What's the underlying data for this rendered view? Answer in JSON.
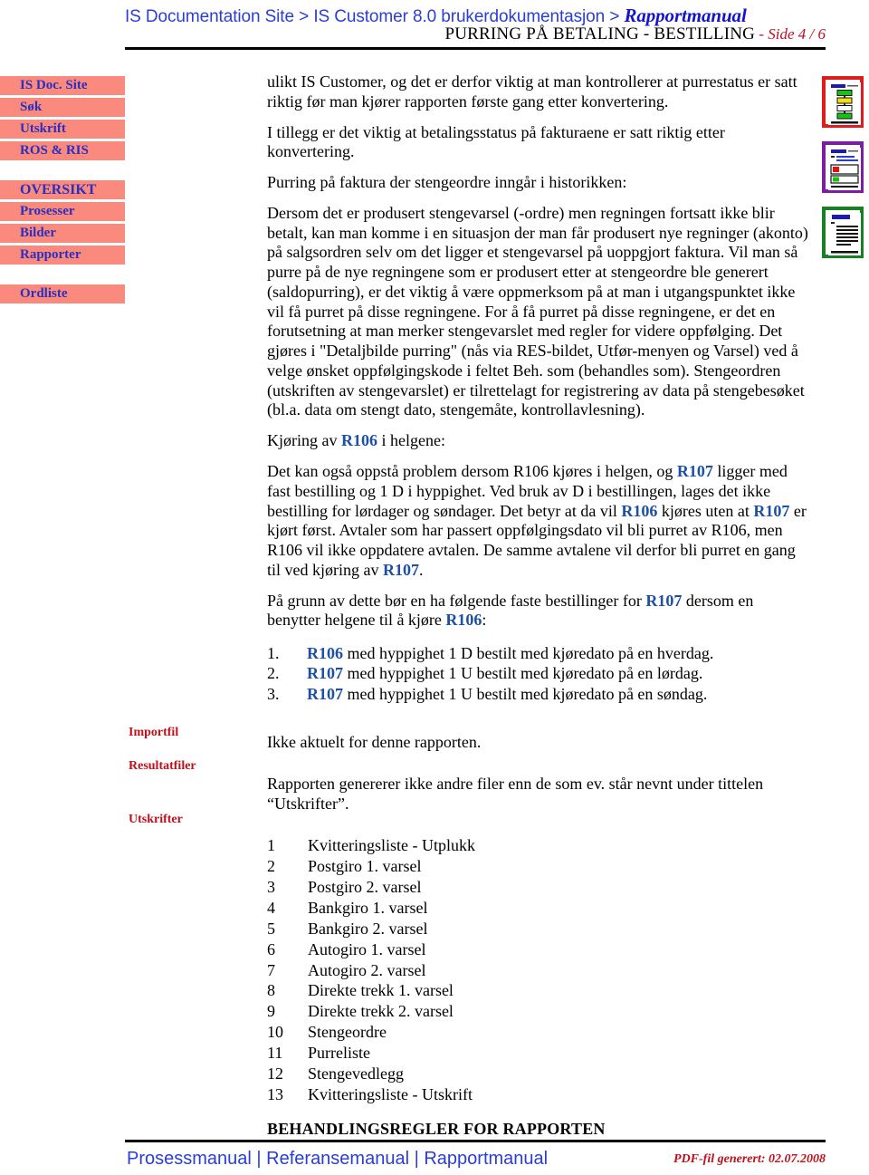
{
  "header": {
    "breadcrumb_part1": "IS Documentation Site",
    "breadcrumb_sep1": " > ",
    "breadcrumb_part2": "IS Customer 8.0 brukerdokumentasjon",
    "breadcrumb_sep2": " > ",
    "breadcrumb_part3": "Rapportmanual",
    "doc_title": "PURRING PÅ BETALING - BESTILLING",
    "page_indicator": " - Side 4 / 6"
  },
  "sidebar": {
    "group1": [
      {
        "label": "IS Doc. Site"
      },
      {
        "label": "Søk"
      },
      {
        "label": "Utskrift"
      },
      {
        "label": "ROS & RIS"
      }
    ],
    "group2": [
      {
        "label": "OVERSIKT"
      },
      {
        "label": "Prosesser"
      },
      {
        "label": "Bilder"
      },
      {
        "label": "Rapporter"
      }
    ],
    "group3": [
      {
        "label": "Ordliste"
      }
    ]
  },
  "side_labels": {
    "importfil": "Importfil",
    "resultatfiler": "Resultatfiler",
    "utskrifter": "Utskrifter"
  },
  "main": {
    "p1": "ulikt IS Customer, og det er derfor viktig at man kontrollerer at purrestatus er satt riktig før man kjører rapporten første gang etter konvertering.",
    "p2": "I tillegg er det viktig at betalingsstatus på fakturaene er satt riktig etter konvertering.",
    "p3": "Purring på faktura der stengeordre inngår i historikken:",
    "p4": "Dersom det er produsert stengevarsel (-ordre) men regningen fortsatt ikke blir betalt, kan man komme i en situasjon der man får produsert nye regninger (akonto) på salgsordren selv om det ligger et stengevarsel på uoppgjort faktura. Vil man så purre på de nye regningene som er produsert etter at stengeordre ble generert (saldopurring), er det viktig å være oppmerksom på at man i utgangspunktet ikke vil få purret på disse regningene. For å få purret på disse regningene, er det en forutsetning at man merker stengevarslet med regler for videre oppfølging. Det gjøres i \"Detaljbilde purring\" (nås via RES-bildet, Utfør-menyen og Varsel) ved å velge ønsket oppfølgingskode i feltet Beh. som (behandles som). Stengeordren (utskriften av stengevarslet) er tilrettelagt for registrering av data på stengebesøket (bl.a. data om stengt dato, stengemåte, kontrollavlesning).",
    "p5_prefix": "Kjøring av ",
    "p5_code": "R106",
    "p5_suffix": " i helgene:",
    "p6_seg1": "Det kan også oppstå problem dersom R106 kjøres i helgen, og ",
    "p6_code1": "R107",
    "p6_seg2": " ligger med fast bestilling og 1 D i hyppighet. Ved bruk av D i bestillingen, lages det ikke bestilling for lørdager og søndager. Det betyr at da vil ",
    "p6_code2": "R106",
    "p6_seg3": " kjøres uten at ",
    "p6_code3": "R107",
    "p6_seg4": " er kjørt først. Avtaler som har passert oppfølgingsdato vil bli purret av R106, men R106 vil ikke oppdatere avtalen. De samme avtalene vil derfor bli purret en gang til ved kjøring av ",
    "p6_code4": "R107",
    "p6_seg5": ".",
    "p7_seg1": "På grunn av dette bør en ha følgende faste bestillinger for ",
    "p7_code1": "R107",
    "p7_seg2": " dersom en benytter helgene til å kjøre ",
    "p7_code2": "R106",
    "p7_seg3": ":",
    "numbered_list": [
      {
        "num": "1.",
        "code": "R106",
        "text": " med hyppighet 1 D bestilt med kjøredato på en hverdag."
      },
      {
        "num": "2.",
        "code": "R107",
        "text": " med hyppighet 1 U bestilt med kjøredato på en lørdag."
      },
      {
        "num": "3.",
        "code": "R107",
        "text": " med hyppighet 1 U bestilt med kjøredato på en søndag."
      }
    ],
    "importfil_text": "Ikke aktuelt for denne rapporten.",
    "resultatfiler_text": "Rapporten genererer ikke andre filer enn de som ev. står nevnt under tittelen “Utskrifter”.",
    "printouts": [
      {
        "num": "1",
        "label": "Kvitteringsliste - Utplukk"
      },
      {
        "num": "2",
        "label": "Postgiro 1. varsel"
      },
      {
        "num": "3",
        "label": "Postgiro 2. varsel"
      },
      {
        "num": "4",
        "label": "Bankgiro 1. varsel"
      },
      {
        "num": "5",
        "label": "Bankgiro 2. varsel"
      },
      {
        "num": "6",
        "label": "Autogiro 1. varsel"
      },
      {
        "num": "7",
        "label": "Autogiro 2. varsel"
      },
      {
        "num": "8",
        "label": "Direkte trekk 1. varsel"
      },
      {
        "num": "9",
        "label": "Direkte trekk 2. varsel"
      },
      {
        "num": "10",
        "label": "Stengeordre"
      },
      {
        "num": "11",
        "label": "Purreliste"
      },
      {
        "num": "12",
        "label": "Stengevedlegg"
      },
      {
        "num": "13",
        "label": "Kvitteringsliste - Utskrift"
      }
    ],
    "section_heading": "BEHANDLINGSREGLER FOR RAPPORTEN"
  },
  "icons": [
    {
      "name": "flowchart-document-icon",
      "border_color": "#e01b1b"
    },
    {
      "name": "form-dialog-document-icon",
      "border_color": "#7b1fa2"
    },
    {
      "name": "text-document-icon",
      "border_color": "#1a8026"
    }
  ],
  "footer": {
    "link1": "Prosessmanual",
    "sep1": " | ",
    "link2": "Referansemanual",
    "sep2": " | ",
    "link3": "Rapportmanual",
    "generated": "PDF-fil generert: 02.07.2008"
  },
  "colors": {
    "nav_bg": "#fa8a7e",
    "nav_text": "#2a2fc0",
    "link_blue": "#2a3ed4",
    "accent_red": "#c0101c",
    "code_blue": "#1d4fa5"
  }
}
